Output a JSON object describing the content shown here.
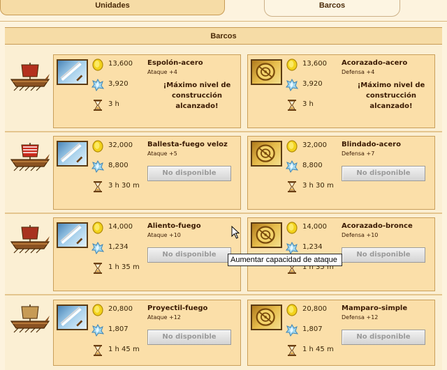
{
  "tabs": [
    {
      "label": "Unidades",
      "active": false
    },
    {
      "label": "Barcos",
      "active": true
    }
  ],
  "section_title": "Barcos",
  "ships": [
    {
      "name": "ship-row-1",
      "attack": {
        "name": "Espolón-acero",
        "bonus": "Ataque +4",
        "gold": "13,600",
        "crystal": "3,920",
        "time": "3 h",
        "status": "max",
        "max_message": "¡Máximo nivel de construcción alcanzado!"
      },
      "defense": {
        "name": "Acorazado-acero",
        "bonus": "Defensa +4",
        "gold": "13,600",
        "crystal": "3,920",
        "time": "3 h",
        "status": "max",
        "max_message": "¡Máximo nivel de construcción alcanzado!"
      }
    },
    {
      "name": "ship-row-2",
      "attack": {
        "name": "Ballesta-fuego veloz",
        "bonus": "Ataque +5",
        "gold": "32,000",
        "crystal": "8,800",
        "time": "3 h 30 m",
        "status": "unavailable",
        "button": "No disponible"
      },
      "defense": {
        "name": "Blindado-acero",
        "bonus": "Defensa +7",
        "gold": "32,000",
        "crystal": "8,800",
        "time": "3 h 30 m",
        "status": "unavailable",
        "button": "No disponible"
      }
    },
    {
      "name": "ship-row-3",
      "attack": {
        "name": "Aliento-fuego",
        "bonus": "Ataque +10",
        "gold": "14,000",
        "crystal": "1,234",
        "time": "1 h 35 m",
        "status": "unavailable",
        "button": "No disponible"
      },
      "defense": {
        "name": "Acorazado-bronce",
        "bonus": "Defensa +10",
        "gold": "14,000",
        "crystal": "1,234",
        "time": "1 h 35 m",
        "status": "unavailable",
        "button": "No disponible"
      }
    },
    {
      "name": "ship-row-4",
      "attack": {
        "name": "Proyectil-fuego",
        "bonus": "Ataque +12",
        "gold": "20,800",
        "crystal": "1,807",
        "time": "1 h 45 m",
        "status": "unavailable",
        "button": "No disponible"
      },
      "defense": {
        "name": "Mamparo-simple",
        "bonus": "Defensa +12",
        "gold": "20,800",
        "crystal": "1,807",
        "time": "1 h 45 m",
        "status": "unavailable",
        "button": "No disponible"
      }
    }
  ],
  "tooltip": "Aumentar capacidad de ataque",
  "icons": {
    "gold": "gold-coin-icon",
    "crystal": "crystal-icon",
    "time": "hourglass-icon",
    "attack": "sword-upgrade-icon",
    "defense": "shield-upgrade-icon"
  },
  "colors": {
    "card_bg": "#fbdfa9",
    "card_border": "#c99f5a",
    "header_bg": "#f6dca6",
    "text": "#3a1a02",
    "disabled_text": "#9a9a9a"
  }
}
